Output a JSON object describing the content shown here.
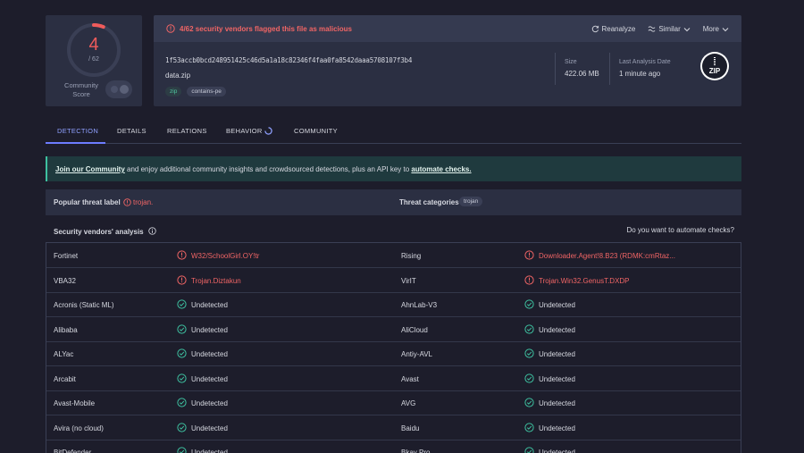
{
  "score": {
    "detections": "4",
    "total": "/ 62",
    "label": "Community\nScore"
  },
  "alert": {
    "text": "4/62 security vendors flagged this file as malicious"
  },
  "actions": {
    "reanalyze": "Reanalyze",
    "similar": "Similar",
    "more": "More"
  },
  "file": {
    "hash": "1f53accb0bcd248951425c46d5a1a18c82346f4faa0fa8542daaa5708107f3b4",
    "name": "data.zip",
    "tags": [
      "zip",
      "contains-pe"
    ],
    "size_label": "Size",
    "size_value": "422.06 MB",
    "last_label": "Last Analysis Date",
    "last_value": "1 minute ago",
    "type_icon_text": "ZIP"
  },
  "tabs": [
    "DETECTION",
    "DETAILS",
    "RELATIONS",
    "BEHAVIOR",
    "COMMUNITY"
  ],
  "banner": {
    "link1": "Join our Community",
    "middle": " and enjoy additional community insights and crowdsourced detections, plus an API key to ",
    "link2": "automate checks."
  },
  "threat": {
    "popular_label": "Popular threat label",
    "popular_value": "trojan.",
    "categories_label": "Threat categories",
    "categories_value": "trojan"
  },
  "vendors_header": {
    "title": "Security vendors' analysis",
    "automate": "Do you want to automate checks?"
  },
  "rows": [
    {
      "v1": "Fortinet",
      "r1": "W32/SchoolGirl.OY!tr",
      "m1": true,
      "v2": "Rising",
      "r2": "Downloader.Agent!8.B23 (RDMK:cmRtaz...",
      "m2": true
    },
    {
      "v1": "VBA32",
      "r1": "Trojan.Diztakun",
      "m1": true,
      "v2": "VirIT",
      "r2": "Trojan.Win32.GenusT.DXDP",
      "m2": true
    },
    {
      "v1": "Acronis (Static ML)",
      "r1": "Undetected",
      "m1": false,
      "v2": "AhnLab-V3",
      "r2": "Undetected",
      "m2": false
    },
    {
      "v1": "Alibaba",
      "r1": "Undetected",
      "m1": false,
      "v2": "AliCloud",
      "r2": "Undetected",
      "m2": false
    },
    {
      "v1": "ALYac",
      "r1": "Undetected",
      "m1": false,
      "v2": "Antiy-AVL",
      "r2": "Undetected",
      "m2": false
    },
    {
      "v1": "Arcabit",
      "r1": "Undetected",
      "m1": false,
      "v2": "Avast",
      "r2": "Undetected",
      "m2": false
    },
    {
      "v1": "Avast-Mobile",
      "r1": "Undetected",
      "m1": false,
      "v2": "AVG",
      "r2": "Undetected",
      "m2": false
    },
    {
      "v1": "Avira (no cloud)",
      "r1": "Undetected",
      "m1": false,
      "v2": "Baidu",
      "r2": "Undetected",
      "m2": false
    },
    {
      "v1": "BitDefender",
      "r1": "Undetected",
      "m1": false,
      "v2": "Bkav Pro",
      "r2": "Undetected",
      "m2": false
    }
  ],
  "colors": {
    "malicious": "#f06565",
    "clean": "#3ec1a0",
    "accent": "#6d7cff",
    "bg": "#1d1d2b",
    "card": "#2b2f42"
  }
}
